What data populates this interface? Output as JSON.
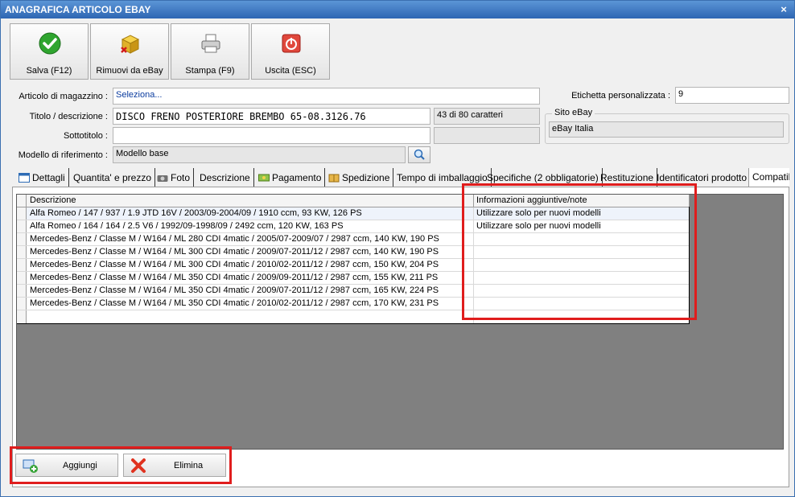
{
  "window": {
    "title": "ANAGRAFICA ARTICOLO EBAY",
    "close_glyph": "×"
  },
  "toolbar": {
    "save_label": "Salva (F12)",
    "remove_label": "Rimuovi da eBay",
    "print_label": "Stampa (F9)",
    "exit_label": "Uscita (ESC)"
  },
  "form": {
    "article_label": "Articolo di magazzino :",
    "article_value": "Seleziona...",
    "title_label": "Titolo / descrizione :",
    "title_value": "DISCO FRENO POSTERIORE BREMBO 65-08.3126.76",
    "char_count": "43 di 80 caratteri",
    "subtitle_label": "Sottotitolo :",
    "subtitle_value": "",
    "model_label": "Modello di riferimento :",
    "model_value": "Modello base",
    "custom_label_label": "Etichetta personalizzata :",
    "custom_label_value": "9",
    "site_group_title": "Sito eBay",
    "site_value": "eBay Italia"
  },
  "tabs": [
    {
      "label": "Dettagli",
      "icon": "calendar-icon"
    },
    {
      "label": "Quantita' e prezzo"
    },
    {
      "label": "Foto",
      "icon": "camera-icon"
    },
    {
      "label": "Descrizione"
    },
    {
      "label": "Pagamento",
      "icon": "money-icon"
    },
    {
      "label": "Spedizione",
      "icon": "box-icon"
    },
    {
      "label": "Tempo di imballaggio"
    },
    {
      "label": "Specifiche (2 obbligatorie)"
    },
    {
      "label": "Restituzione"
    },
    {
      "label": "Identificatori prodotto"
    },
    {
      "label": "Compatib"
    }
  ],
  "grid": {
    "columns": [
      "Descrizione",
      "Informazioni aggiuntive/note"
    ],
    "rows": [
      [
        "Alfa Romeo / 147 / 937 / 1.9 JTD 16V / 2003/09-2004/09 / 1910 ccm, 93 KW, 126 PS",
        "Utilizzare solo per nuovi modelli"
      ],
      [
        "Alfa Romeo / 164 / 164 / 2.5 V6 / 1992/09-1998/09 / 2492 ccm, 120 KW, 163 PS",
        "Utilizzare solo per nuovi modelli"
      ],
      [
        "Mercedes-Benz / Classe M / W164 / ML 280 CDI 4matic / 2005/07-2009/07 / 2987 ccm, 140 KW, 190 PS",
        ""
      ],
      [
        "Mercedes-Benz / Classe M / W164 / ML 300 CDI 4matic / 2009/07-2011/12 / 2987 ccm, 140 KW, 190 PS",
        ""
      ],
      [
        "Mercedes-Benz / Classe M / W164 / ML 300 CDI 4matic / 2010/02-2011/12 / 2987 ccm, 150 KW, 204 PS",
        ""
      ],
      [
        "Mercedes-Benz / Classe M / W164 / ML 350 CDI 4matic / 2009/09-2011/12 / 2987 ccm, 155 KW, 211 PS",
        ""
      ],
      [
        "Mercedes-Benz / Classe M / W164 / ML 350 CDI 4matic / 2009/07-2011/12 / 2987 ccm, 165 KW, 224 PS",
        ""
      ],
      [
        "Mercedes-Benz / Classe M / W164 / ML 350 CDI 4matic / 2010/02-2011/12 / 2987 ccm, 170 KW, 231 PS",
        ""
      ],
      [
        "",
        ""
      ]
    ]
  },
  "actions": {
    "add_label": "Aggiungi",
    "delete_label": "Elimina"
  },
  "colors": {
    "title_bar": "#2e66b3",
    "highlight": "#e01d1d",
    "grid_bg": "#808080"
  }
}
